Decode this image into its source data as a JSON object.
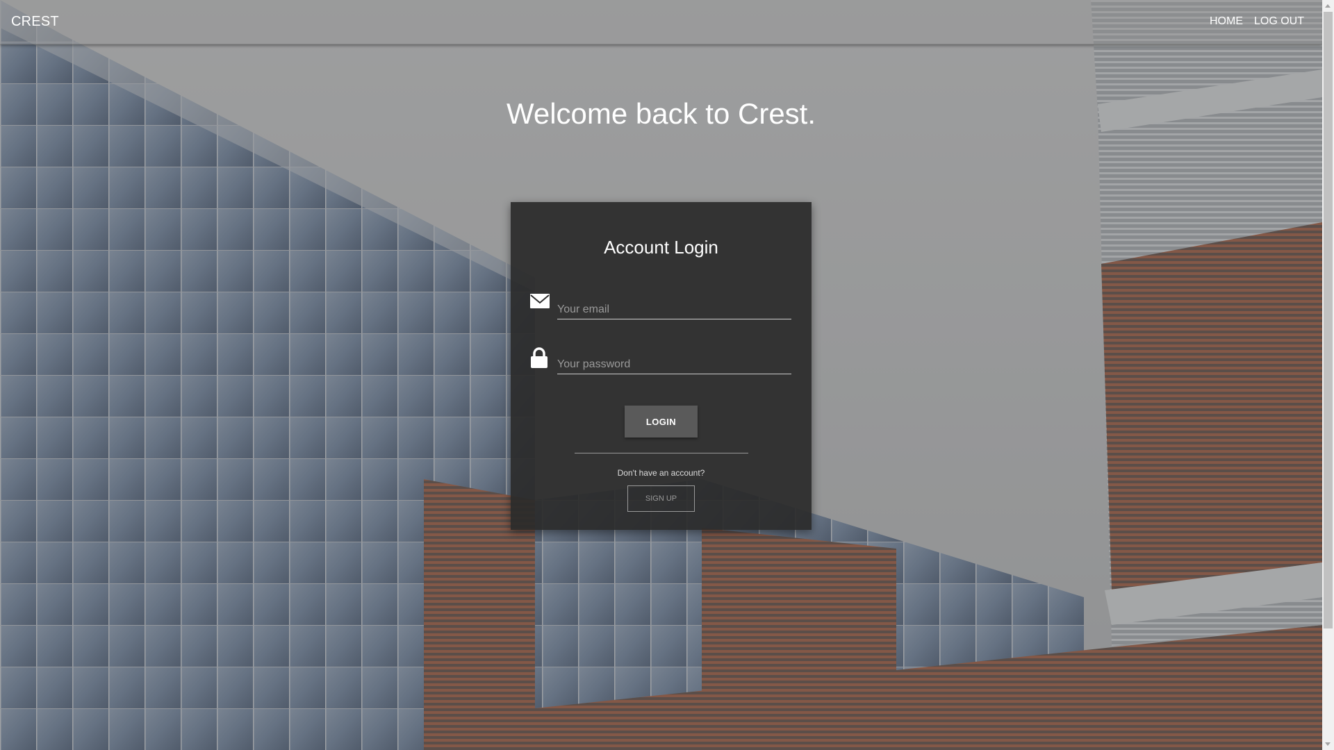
{
  "navbar": {
    "brand": "CREST",
    "links": [
      "HOME",
      "LOG OUT"
    ]
  },
  "hero": {
    "heading": "Welcome back to Crest."
  },
  "login_card": {
    "title": "Account Login",
    "email_placeholder": "Your email",
    "password_placeholder": "Your password",
    "login_label": "LOGIN",
    "signup_prompt": "Don't have an account?",
    "signup_label": "SIGN UP"
  },
  "icons": {
    "email": "envelope-icon",
    "password": "lock-icon"
  },
  "colors": {
    "card_background": "#2a2a2a",
    "login_button": "#5a5a5a",
    "text": "#ffffff"
  }
}
